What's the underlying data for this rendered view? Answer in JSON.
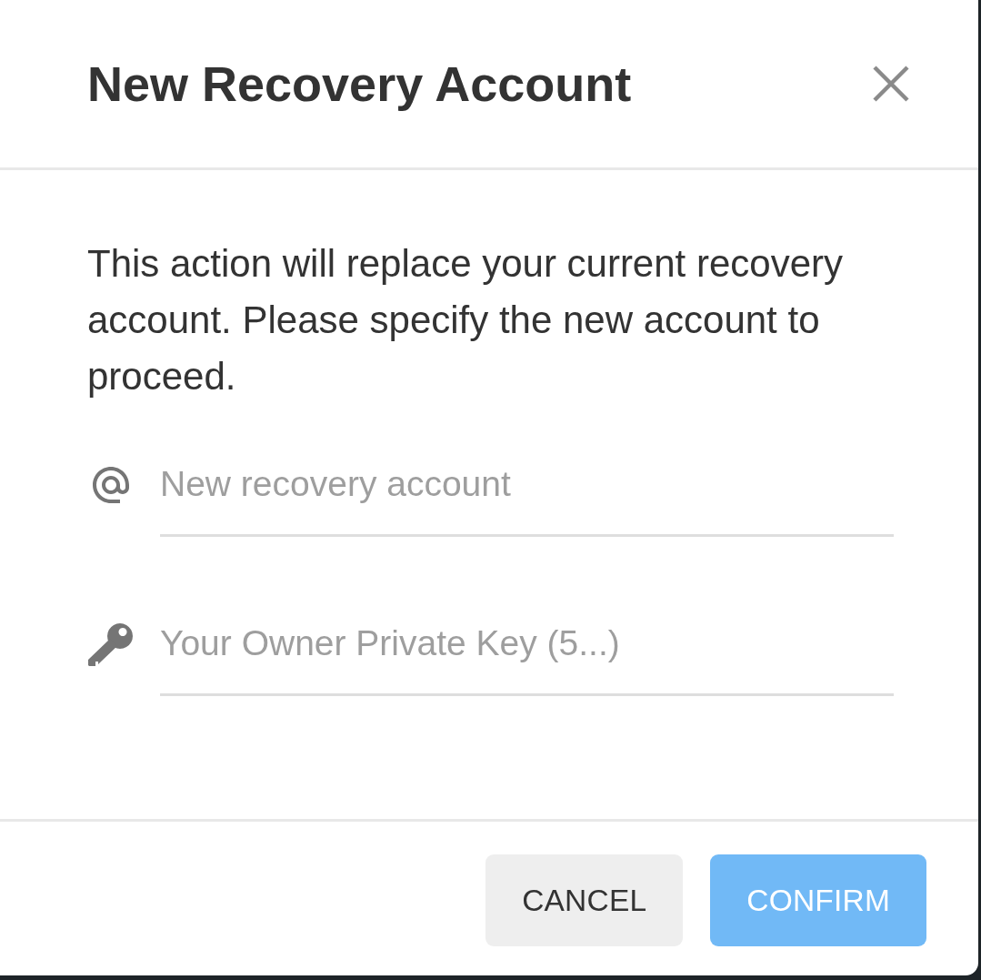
{
  "dialog": {
    "title": "New Recovery Account",
    "message": "This action will replace your current recovery account. Please specify the new account to proceed.",
    "fields": [
      {
        "kind": "account",
        "placeholder": "New recovery account"
      },
      {
        "kind": "key",
        "placeholder": "Your Owner Private Key (5...)"
      }
    ],
    "buttons": [
      {
        "label": "CANCEL",
        "kind": "secondary",
        "disabled": false
      },
      {
        "label": "CONFIRM",
        "kind": "primary",
        "disabled": true
      }
    ]
  }
}
